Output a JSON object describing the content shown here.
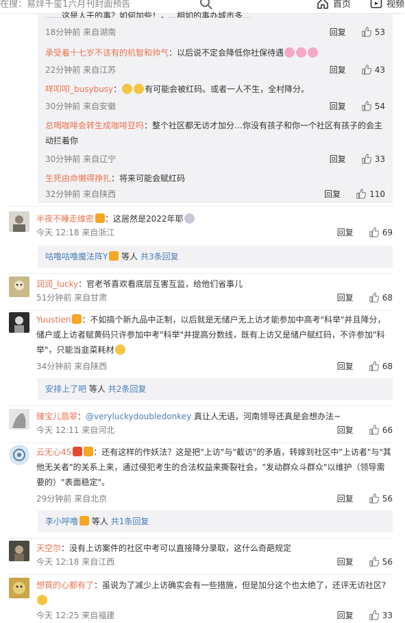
{
  "topbar": {
    "search_text": "在搜：易烊千玺1六月刊封面预告",
    "home_label": "首页",
    "video_label": "视频"
  },
  "colors": {
    "name": "#eb7350",
    "link": "#4a7fb8",
    "meta": "#808080",
    "subbg": "#f2f2f5"
  },
  "labels": {
    "reply": "回复",
    "more_suffix": "等人",
    "like_icon": "thumb-up-icon"
  },
  "sub_comments": [
    {
      "author": "",
      "text": "……这是人干的事？如何加些！，…相如的事办城市多…",
      "time": "18分钟前 来自湖南",
      "likes": "53"
    },
    {
      "author": "承受着十七岁不该有的机智和帅气",
      "text": "：以后说不定会降低你社保待遇",
      "time": "22分钟前 来自江苏",
      "likes": "43"
    },
    {
      "author": "咩叩叩_busybusy",
      "text": "有可能会被红码。或者一人不生，全村降分。",
      "time": "30分钟前 来自安徽",
      "likes": "54"
    },
    {
      "author": "总喝咖啡会转生成咖啡豆吗",
      "text": "：整个社区都无访才加分…你没有孩子和你一个社区有孩子的会主动拦着你",
      "time": "30分钟前 来自辽宁",
      "likes": "33"
    },
    {
      "author": "生死由命懒得挣扎",
      "text": "：将来可能会赋红码",
      "time": "32分钟前 来自陕西",
      "likes": "110"
    }
  ],
  "comments": [
    {
      "author": "半夜不睡走维密",
      "text": "：这居然是2022年耶",
      "time": "今天 12:18 来自浙江",
      "likes": "69",
      "more": {
        "user": "咕噜咕噜魔法阵Y",
        "count": "共3条回复"
      }
    },
    {
      "author": "润润_lucky",
      "text": "：官老爷喜欢看底层互害互监，给他们省事儿",
      "time": "51分钟前 来自甘肃",
      "likes": "68",
      "more": null
    },
    {
      "author": "Yuustien",
      "text": "：不如搞个新九品中正制，以后就是无储户无上访才能参加中高考\"科举\"并且降分，储户或上访者赋黄码只许参加中考\"科举\"并提高分数线，既有上访又是储户赋红码，不许参加\"科举\"，只能当韭菜耗材",
      "time": "34分钟前 来自陕西",
      "likes": "68",
      "more": {
        "user": "安排上了吧",
        "count": "共2条回复"
      }
    },
    {
      "author": "臻宝儿翡翠",
      "text": "：",
      "mention": "@veryluckydoubledonkey",
      "text2": " 真让人无语，河南领导还真是会想办法~",
      "time": "今天 12:11 来自河北",
      "likes": "66",
      "more": null
    },
    {
      "author": "云无心45",
      "text": "：还有这样的作妖法？这是把\"上访\"与\"截访\"的矛盾，转嫁到社区中\"上访者\"与\"其他无关者\"的关系上来，通过侵犯考生的合法权益来撕裂社会，\"发动群众斗群众\"以维护（领导需要的）\"表面稳定\"。",
      "time": "29分钟前 来自北京",
      "likes": "56",
      "more": {
        "user": "李小呼噜",
        "count": "共1条回复"
      }
    },
    {
      "author": "天空尔",
      "text": "：没有上访案件的社区中考可以直接降分录取，这什么奇葩规定",
      "time": "今天 12:18 来自江西",
      "likes": "56",
      "more": null
    },
    {
      "author": "想買的心都有了",
      "text": "：虽说为了减少上访确实会有一些措施，但是加分这个也太绝了，还评无访社区?",
      "time": "今天 12:25 来自福建",
      "likes": "33",
      "more": null
    }
  ]
}
